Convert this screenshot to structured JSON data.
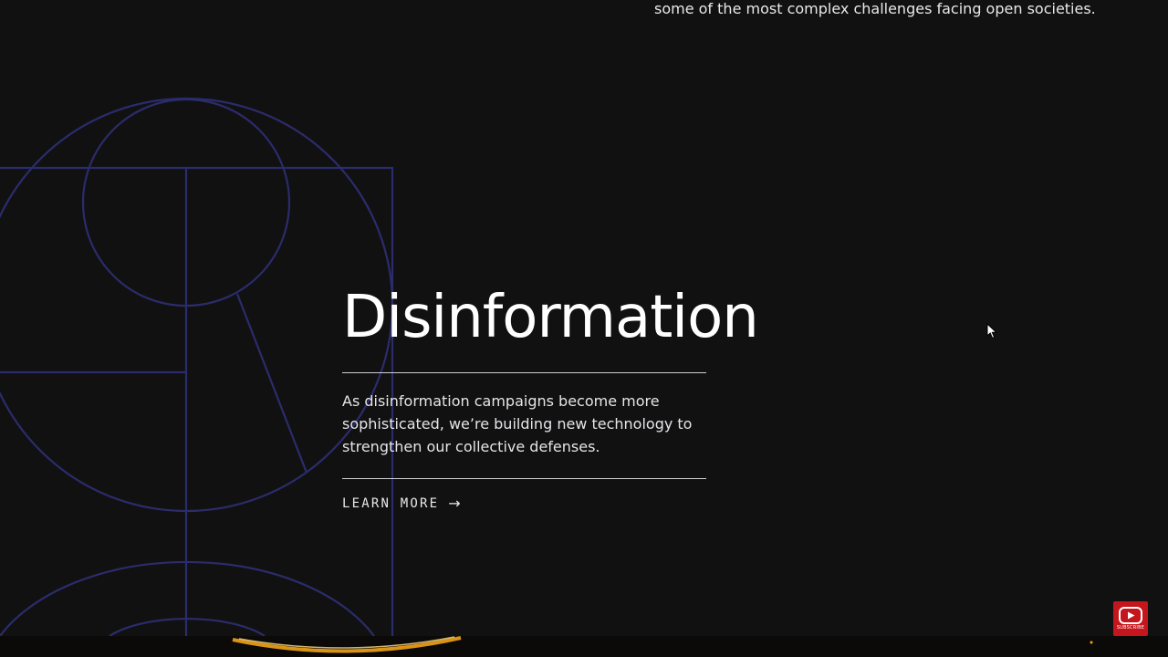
{
  "header": {
    "tagline_fragment": "some of the most complex challenges facing open societies."
  },
  "section": {
    "title": "Disinformation",
    "description": "As disinformation campaigns become more sophisticated, we’re building new technology to strengthen our collective defenses.",
    "cta_label": "LEARN MORE",
    "cta_arrow": "→"
  },
  "overlay": {
    "subscribe_label": "SUBSCRIBE"
  },
  "icons": {
    "cta": "arrow-right-icon",
    "cursor": "mouse-cursor-icon",
    "subscribe": "youtube-play-icon"
  },
  "colors": {
    "background": "#111112",
    "art_stroke": "#2b2c6b",
    "text": "#ffffff",
    "subscribe_bg": "#c4161c",
    "glow": "#f0a21a"
  }
}
